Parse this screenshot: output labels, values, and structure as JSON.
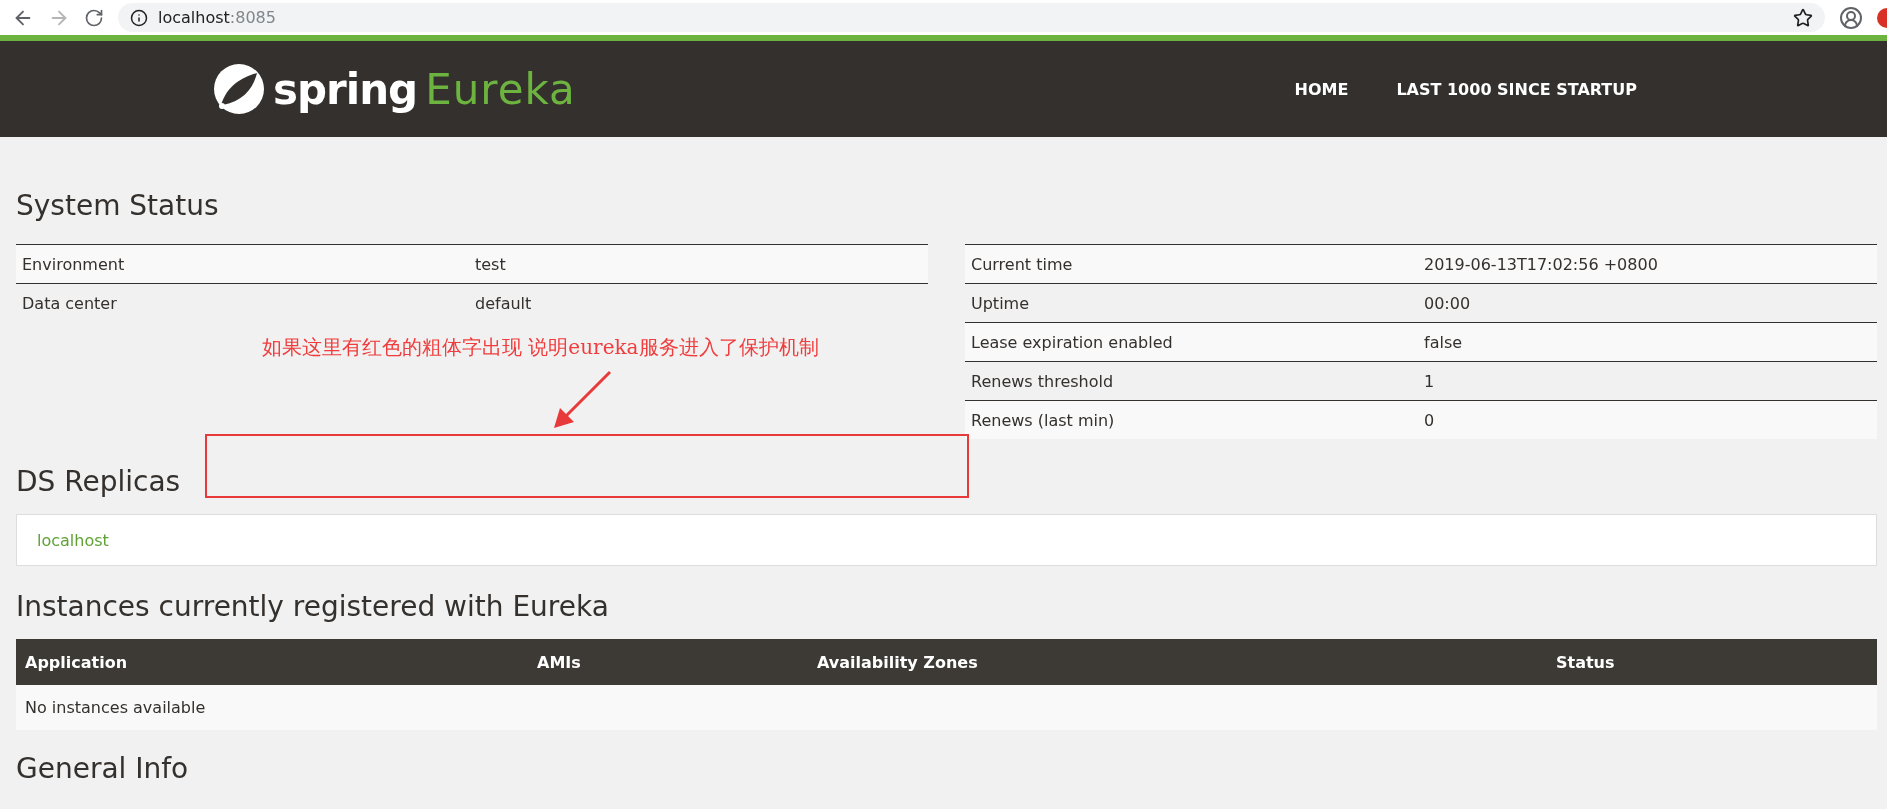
{
  "browser": {
    "url_host": "localhost",
    "url_port": ":8085",
    "forward_disabled": true
  },
  "navbar": {
    "brand_word": "spring",
    "brand_product": "Eureka",
    "links": [
      "HOME",
      "LAST 1000 SINCE STARTUP"
    ]
  },
  "system_status": {
    "title": "System Status",
    "left_rows": [
      {
        "name": "Environment",
        "value": "test"
      },
      {
        "name": "Data center",
        "value": "default"
      }
    ],
    "right_rows": [
      {
        "name": "Current time",
        "value": "2019-06-13T17:02:56 +0800"
      },
      {
        "name": "Uptime",
        "value": "00:00"
      },
      {
        "name": "Lease expiration enabled",
        "value": "false"
      },
      {
        "name": "Renews threshold",
        "value": "1"
      },
      {
        "name": "Renews (last min)",
        "value": "0"
      }
    ]
  },
  "annotation": {
    "text": "如果这里有红色的粗体字出现 说明eureka服务进入了保护机制"
  },
  "ds_replicas": {
    "title": "DS Replicas",
    "items": [
      "localhost"
    ]
  },
  "instances": {
    "title": "Instances currently registered with Eureka",
    "columns": [
      "Application",
      "AMIs",
      "Availability Zones",
      "Status"
    ],
    "empty_text": "No instances available"
  },
  "general_info": {
    "title": "General Info"
  }
}
